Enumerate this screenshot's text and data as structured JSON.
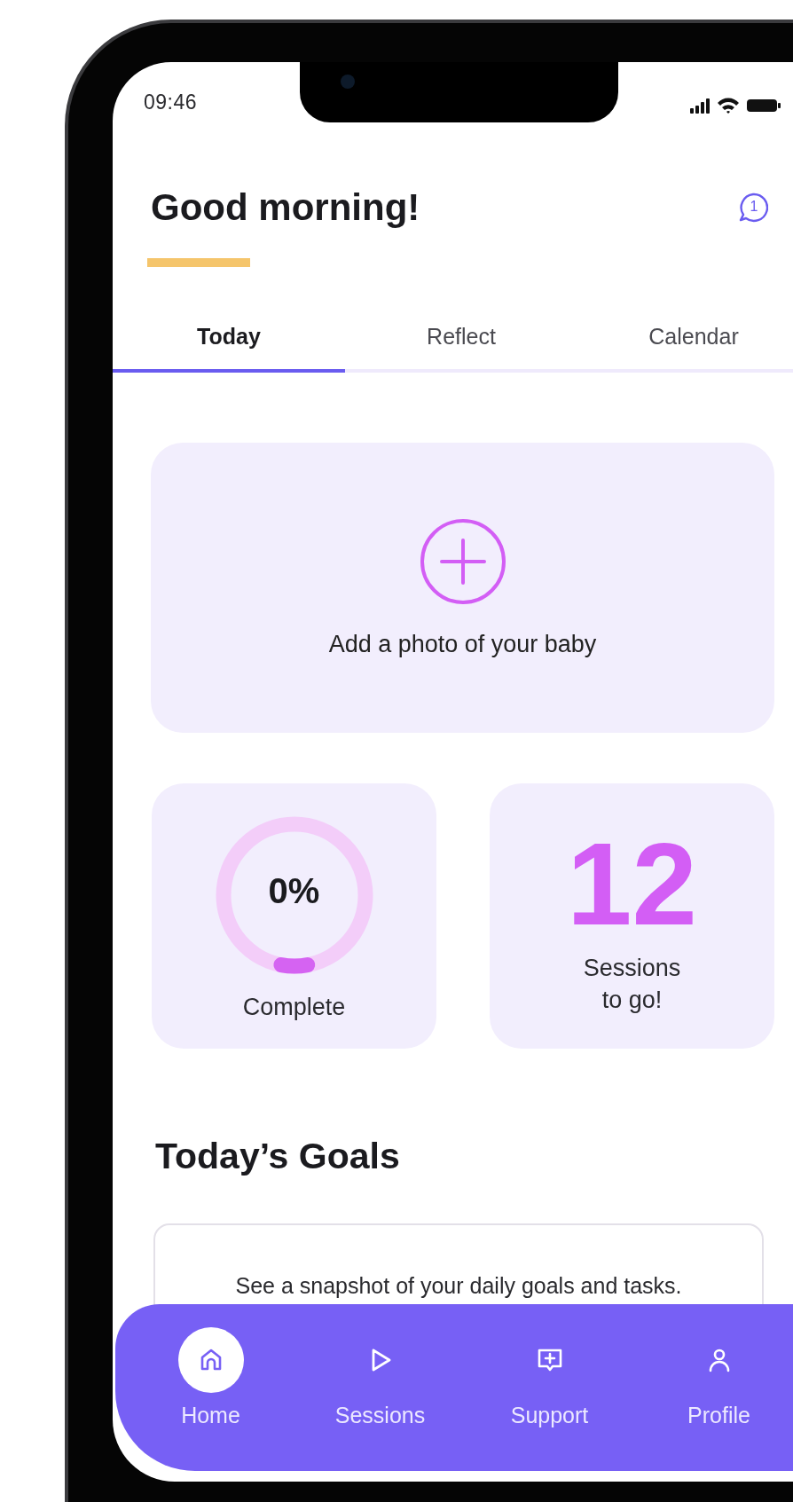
{
  "status_bar": {
    "time": "09:46"
  },
  "header": {
    "title": "Good morning!",
    "notifications": "1"
  },
  "tabs": [
    {
      "label": "Today",
      "selected": true
    },
    {
      "label": "Reflect",
      "selected": false
    },
    {
      "label": "Calendar",
      "selected": false
    }
  ],
  "photo_card": {
    "label": "Add a photo of your baby"
  },
  "progress_card": {
    "value": "0%",
    "label": "Complete",
    "level": 0
  },
  "sessions_card": {
    "count": "12",
    "label": "Sessions to go!"
  },
  "goals": {
    "title": "Today’s Goals",
    "description": "See a snapshot of your daily goals and tasks."
  },
  "bottom_nav": [
    {
      "label": "Home",
      "kind": "home",
      "selected": true
    },
    {
      "label": "Sessions",
      "kind": "sessions",
      "selected": false
    },
    {
      "label": "Support",
      "kind": "support",
      "selected": false
    },
    {
      "label": "Profile",
      "kind": "profile",
      "selected": false
    }
  ]
}
